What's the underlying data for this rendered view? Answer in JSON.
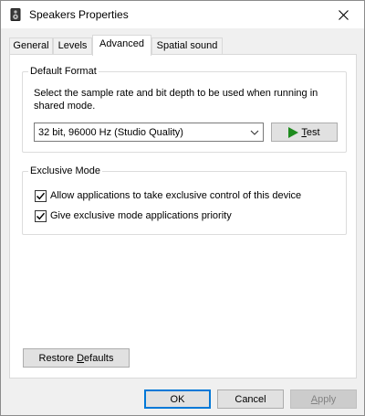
{
  "window": {
    "title": "Speakers Properties",
    "icon": "speaker-icon",
    "close_icon": "close-icon"
  },
  "tabs": [
    {
      "label": "General",
      "active": false
    },
    {
      "label": "Levels",
      "active": false
    },
    {
      "label": "Advanced",
      "active": true
    },
    {
      "label": "Spatial sound",
      "active": false
    }
  ],
  "default_format": {
    "legend": "Default Format",
    "description": "Select the sample rate and bit depth to be used when running in shared mode.",
    "selected_format": "32 bit, 96000 Hz (Studio Quality)",
    "test_button": {
      "label_pre": "",
      "label_ul": "T",
      "label_post": "est",
      "icon": "play-icon",
      "icon_color": "#1e8b1e"
    }
  },
  "exclusive_mode": {
    "legend": "Exclusive Mode",
    "options": [
      {
        "label": "Allow applications to take exclusive control of this device",
        "checked": true
      },
      {
        "label": "Give exclusive mode applications priority",
        "checked": true
      }
    ]
  },
  "restore_defaults": {
    "label_pre": "Restore ",
    "label_ul": "D",
    "label_post": "efaults"
  },
  "footer": {
    "ok": "OK",
    "cancel": "Cancel",
    "apply": {
      "label_ul": "A",
      "label_post": "pply",
      "disabled": true
    }
  },
  "colors": {
    "accent": "#0078d7",
    "panel_bg": "#ffffff",
    "window_bg": "#f0f0f0"
  }
}
